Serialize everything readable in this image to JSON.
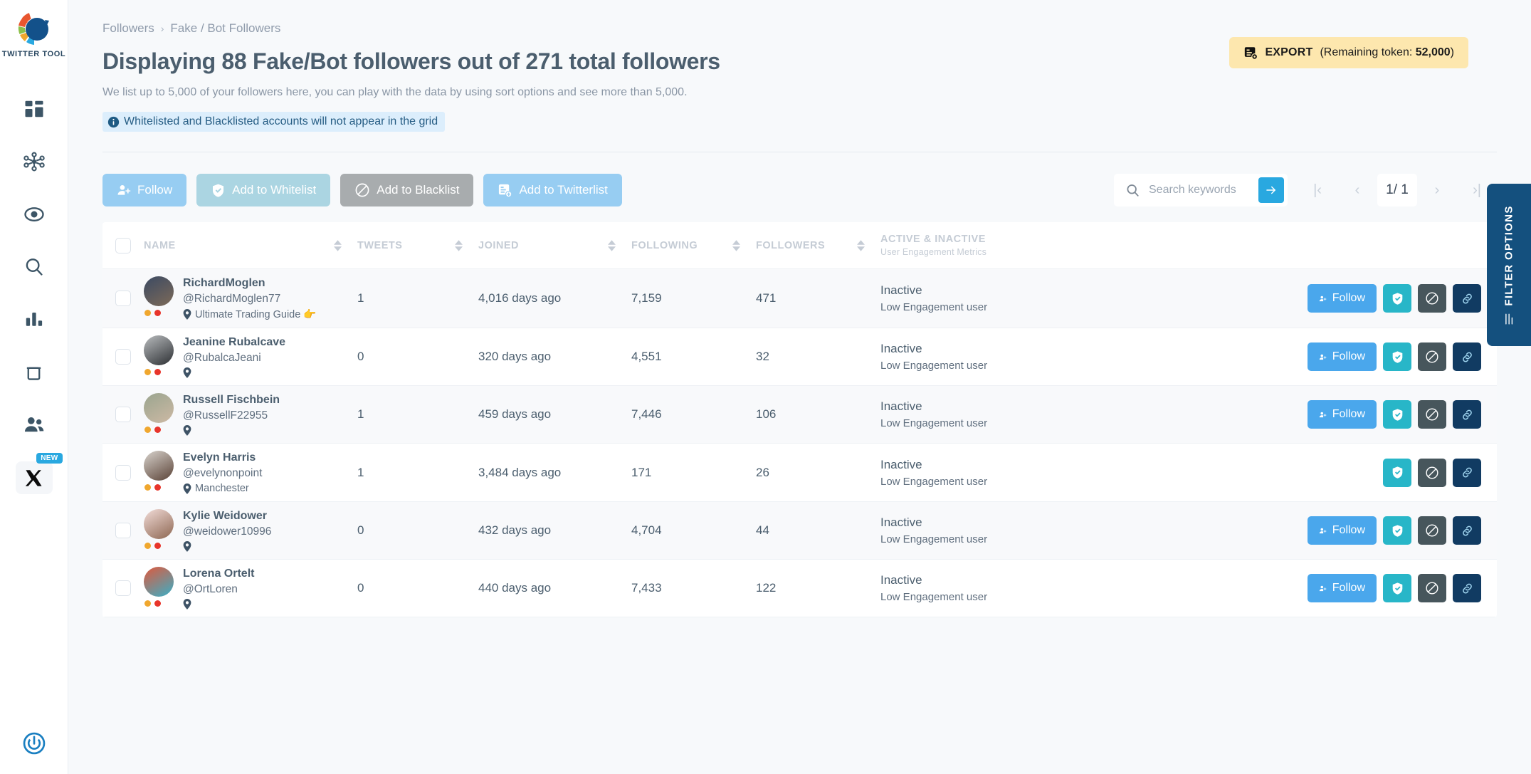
{
  "sidebar": {
    "logo_label": "TWITTER TOOL",
    "items": [
      {
        "name": "dashboard",
        "icon": "dashboard-icon"
      },
      {
        "name": "network",
        "icon": "network-icon"
      },
      {
        "name": "monitor",
        "icon": "eye-target-icon"
      },
      {
        "name": "search",
        "icon": "search-icon"
      },
      {
        "name": "analytics",
        "icon": "bar-chart-icon"
      },
      {
        "name": "trash",
        "icon": "trash-icon"
      },
      {
        "name": "followers",
        "icon": "users-icon"
      },
      {
        "name": "x-platform",
        "icon": "x-logo-icon",
        "badge": "NEW"
      }
    ],
    "bottom_icon": "power-icon"
  },
  "header": {
    "breadcrumb": {
      "parent": "Followers",
      "separator": "›",
      "current": "Fake / Bot Followers"
    },
    "title": "Displaying 88 Fake/Bot followers out of 271 total followers",
    "subtitle": "We list up to 5,000 of your followers here, you can play with the data by using sort options and see more than 5,000.",
    "info_banner": "Whitelisted and Blacklisted accounts will not appear in the grid",
    "export": {
      "label": "EXPORT",
      "rest_prefix": "(Remaining token: ",
      "token": "52,000",
      "rest_suffix": ")"
    }
  },
  "toolbar": {
    "follow_label": "Follow",
    "whitelist_label": "Add to Whitelist",
    "blacklist_label": "Add to Blacklist",
    "twitterlist_label": "Add to Twitterlist",
    "search_placeholder": "Search keywords",
    "search_value": "",
    "pager": {
      "first": "|‹",
      "prev": "‹",
      "current": "1/ 1",
      "next": "›",
      "last": "›|"
    }
  },
  "filter_tab": {
    "label": "FILTER OPTIONS"
  },
  "table": {
    "columns": {
      "name": "NAME",
      "tweets": "TWEETS",
      "joined": "JOINED",
      "following": "FOLLOWING",
      "followers": "FOLLOWERS",
      "active_title": "ACTIVE & INACTIVE",
      "active_sub": "User Engagement Metrics"
    },
    "row_actions": {
      "follow_label": "Follow",
      "whitelist_icon": "shield-check-icon",
      "blacklist_icon": "block-icon",
      "link_icon": "link-icon"
    },
    "rows": [
      {
        "name": "RichardMoglen",
        "handle": "@RichardMoglen77",
        "location": "Ultimate Trading Guide 👉",
        "tweets": "1",
        "joined": "4,016 days ago",
        "following": "7,159",
        "followers": "471",
        "activity": "Inactive",
        "engagement": "Low Engagement user",
        "has_follow": true,
        "avatar_a": "#3b4a63",
        "avatar_b": "#7d6a58"
      },
      {
        "name": "Jeanine Rubalcave",
        "handle": "@RubalcaJeani",
        "location": "",
        "tweets": "0",
        "joined": "320 days ago",
        "following": "4,551",
        "followers": "32",
        "activity": "Inactive",
        "engagement": "Low Engagement user",
        "has_follow": true,
        "avatar_a": "#b9bcbe",
        "avatar_b": "#2c2f33"
      },
      {
        "name": "Russell Fischbein",
        "handle": "@RussellF22955",
        "location": "",
        "tweets": "1",
        "joined": "459 days ago",
        "following": "7,446",
        "followers": "106",
        "activity": "Inactive",
        "engagement": "Low Engagement user",
        "has_follow": true,
        "avatar_a": "#9aa58f",
        "avatar_b": "#cdb9a4"
      },
      {
        "name": "Evelyn Harris",
        "handle": "@evelynonpoint",
        "location": "Manchester",
        "tweets": "1",
        "joined": "3,484 days ago",
        "following": "171",
        "followers": "26",
        "activity": "Inactive",
        "engagement": "Low Engagement user",
        "has_follow": false,
        "avatar_a": "#d8d3cd",
        "avatar_b": "#5a4236"
      },
      {
        "name": "Kylie Weidower",
        "handle": "@weidower10996",
        "location": "",
        "tweets": "0",
        "joined": "432 days ago",
        "following": "4,704",
        "followers": "44",
        "activity": "Inactive",
        "engagement": "Low Engagement user",
        "has_follow": true,
        "avatar_a": "#f2dcd8",
        "avatar_b": "#8d6651"
      },
      {
        "name": "Lorena Ortelt",
        "handle": "@OrtLoren",
        "location": "",
        "tweets": "0",
        "joined": "440 days ago",
        "following": "7,433",
        "followers": "122",
        "activity": "Inactive",
        "engagement": "Low Engagement user",
        "has_follow": true,
        "avatar_a": "#e0583c",
        "avatar_b": "#38b0c8"
      }
    ]
  },
  "colors": {
    "accent_blue": "#29a8e0",
    "follow_blue": "#4aa7ec",
    "whitelist_teal": "#28b6c8",
    "blacklist_slate": "#47565c",
    "link_navy": "#113b62",
    "export_yellow": "#fde7ae",
    "filter_navy": "#14507e",
    "text_dark": "#4b5e6e"
  }
}
